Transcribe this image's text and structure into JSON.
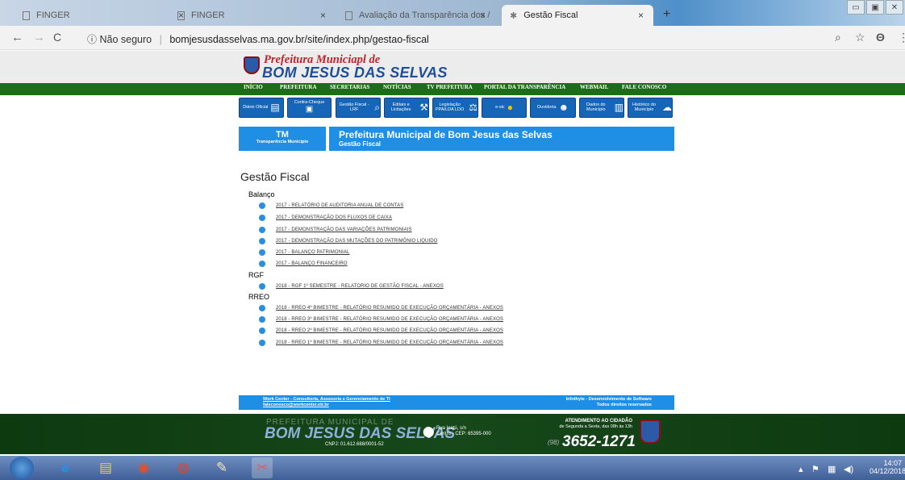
{
  "browser": {
    "tabs": [
      {
        "title": "FINGER",
        "active": false
      },
      {
        "title": "FINGER",
        "active": false
      },
      {
        "title": "Avaliação da Transparência dos /",
        "active": false
      },
      {
        "title": "Gestão Fiscal",
        "active": true
      }
    ],
    "new_tab": "+",
    "security": "Não seguro",
    "url": "bomjesusdasselvas.ma.gov.br/site/index.php/gestao-fiscal"
  },
  "site": {
    "logo_line1": "Prefeitura Municiapl de",
    "logo_line2": "BOM JESUS DAS SELVAS",
    "menu": [
      "INÍCIO",
      "PREFEITURA",
      "SECRETARIAS",
      "NOTÍCIAS",
      "TV PREFEITURA",
      "PORTAL DA TRANSPARÊNCIA",
      "WEBMAIL",
      "FALE CONOSCO"
    ],
    "quick_links": [
      {
        "label": "Diário Oficial",
        "icon": "book-icon"
      },
      {
        "label": "Contra-Cheque",
        "icon": "money-icon"
      },
      {
        "label": "Gestão Fiscal - LRF",
        "icon": "search-doc-icon"
      },
      {
        "label": "Editais e Licitações",
        "icon": "gavel-icon"
      },
      {
        "label": "Legislação PPA/LDA LDO",
        "icon": "scales-icon"
      },
      {
        "label": "e-sic",
        "icon": "info-icon"
      },
      {
        "label": "Ouvidoria",
        "icon": "person-icon"
      },
      {
        "label": "Dados do Município",
        "icon": "chart-icon"
      },
      {
        "label": "Histórico do Município",
        "icon": "chat-icon"
      }
    ]
  },
  "header": {
    "tm": "TM",
    "tm_sub": "Transparência Município",
    "title": "Prefeitura Municipal de Bom Jesus das Selvas",
    "subtitle": "Gestão Fiscal"
  },
  "main": {
    "heading": "Gestão Fiscal",
    "sections": [
      {
        "title": "Balanço",
        "items": [
          "2017 - RELATÓRIO DE AUDITORIA ANUAL DE CONTAS",
          "2017 - DEMONSTRAÇÃO DOS FLUXOS DE CAIXA",
          "2017 - DEMONSTRAÇÃO DAS VARIAÇÕES PATRIMONIAIS",
          "2017 - DEMONSTRAÇÃO DAS MUTAÇÕES DO PATRIMÔNIO LIQUIDO",
          "2017 - BALANÇO PATRIMONIAL",
          "2017 - BALANÇO FINANCEIRO"
        ]
      },
      {
        "title": "RGF",
        "items": [
          "2018 - RGF 1º SEMESTRE - RELATORIO DE GESTÃO FISCAL - ANEXOS"
        ]
      },
      {
        "title": "RREO",
        "items": [
          "2018 - RREO 4º BIMESTRE - RELATÓRIO RESUMIDO DE EXECUÇÃO ORÇAMENTÁRIA - ANEXOS",
          "2018 - RREO 3º BIMESTRE - RELATÓRIO RESUMIDO DE EXECUÇÃO ORÇAMENTÁRIA - ANEXOS",
          "2018 - RREO 2º BIMESTRE - RELATÓRIO RESUMIDO DE EXECUÇÃO ORÇAMENTÁRIA - ANEXOS",
          "2018 - RREO 1º BIMESTRE - RELATÓRIO RESUMIDO DE EXECUÇÃO ORÇAMENTÁRIA - ANEXOS"
        ]
      }
    ]
  },
  "footer": {
    "left1": "Work Center - Consultoria, Assesoria e Gerenciamento de TI",
    "left2": "faleconosco@workcenter.etr.br",
    "right1": "Infothyte - Desenvolvimento de Software",
    "right2": "Todos direitos reservados"
  },
  "bottom": {
    "pref": "PREFEITURA MUNICIPAL DE",
    "name": "BOM JESUS DAS SELVAS",
    "cnpj": "CNPJ: 01.612.688/0001-52",
    "addr1": "Rua Icatú, s/n",
    "addr2": "Centro - CEP: 65395-000",
    "att1": "ATENDIMENTO AO CIDADÃO",
    "att2": "de Segunda a Sexta, das 08h às 13h",
    "area": "(98)",
    "phone": "3652-1271"
  },
  "clock": {
    "time": "14:07",
    "date": "04/12/2018"
  }
}
